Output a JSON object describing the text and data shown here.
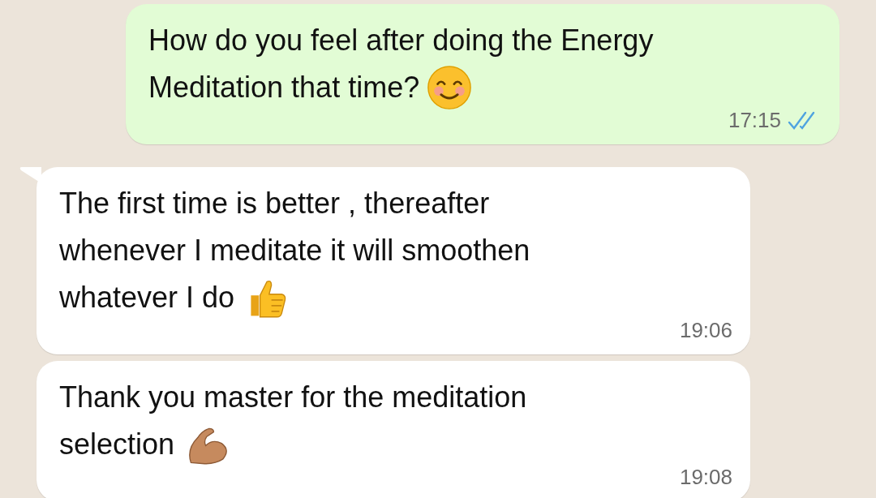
{
  "messages": [
    {
      "kind": "outgoing",
      "lines": [
        "How do you feel after doing the Energy",
        "Meditation that time?"
      ],
      "emoji": {
        "kind": "smiling"
      },
      "time": "17:15",
      "read": true
    },
    {
      "kind": "incoming",
      "lines": [
        "The first time is better , thereafter",
        "whenever I meditate it will smoothen",
        "whatever I do"
      ],
      "emoji": {
        "kind": "thumbs_up"
      },
      "time": "19:06"
    },
    {
      "kind": "incoming",
      "lines": [
        "Thank you master for the meditation",
        "selection"
      ],
      "emoji": {
        "kind": "flexed_arm"
      },
      "time": "19:08"
    }
  ]
}
